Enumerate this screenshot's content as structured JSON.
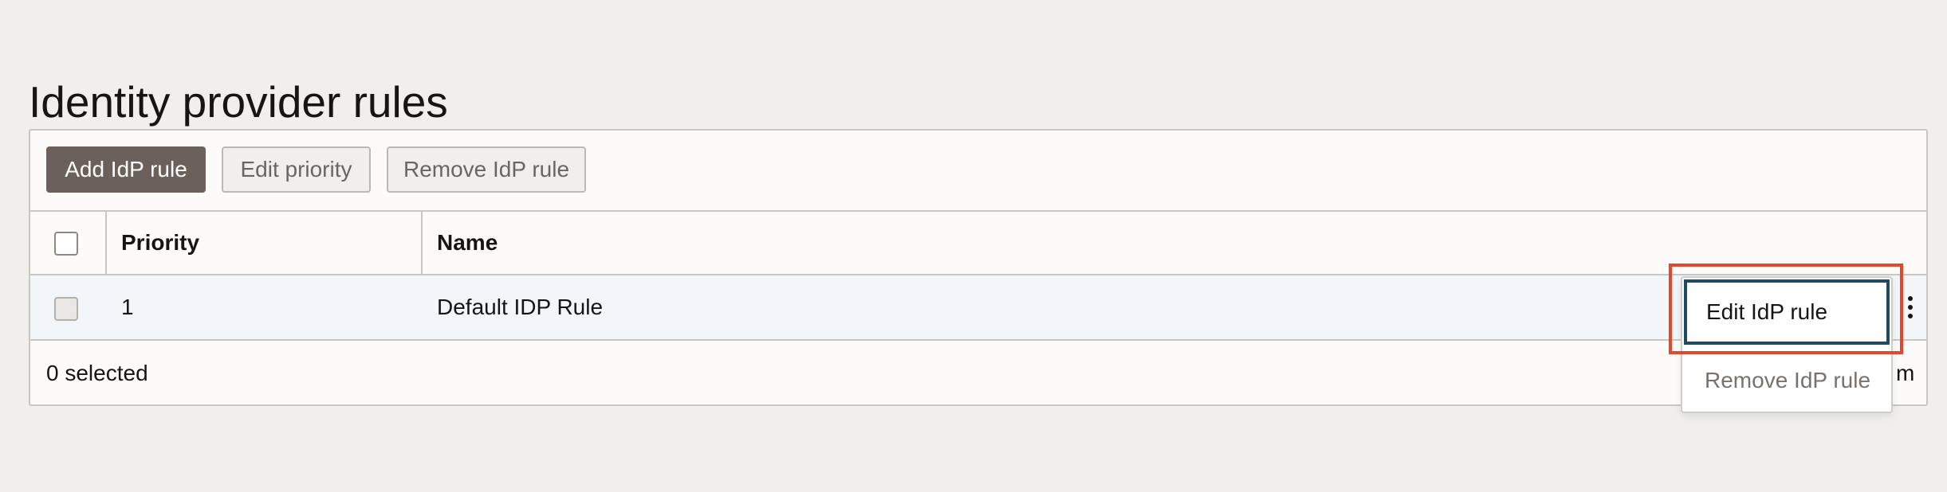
{
  "page": {
    "title": "Identity provider rules"
  },
  "toolbar": {
    "add_label": "Add IdP rule",
    "edit_priority_label": "Edit priority",
    "remove_label": "Remove IdP rule"
  },
  "table": {
    "columns": [
      "Priority",
      "Name"
    ],
    "rows": [
      {
        "priority": "1",
        "name": "Default IDP Rule"
      }
    ]
  },
  "footer": {
    "selected_text": "0 selected",
    "right_text": "m"
  },
  "context_menu": {
    "items": [
      {
        "label": "Edit IdP rule",
        "focused": true
      },
      {
        "label": "Remove IdP rule",
        "focused": false
      }
    ]
  },
  "colors": {
    "primary_button": "#6b615a",
    "highlight_annotation": "#e2482d",
    "focus_ring": "#1f4a60",
    "row_background": "#f2f6f8"
  },
  "icons": {
    "row_actions": "kebab-icon"
  }
}
